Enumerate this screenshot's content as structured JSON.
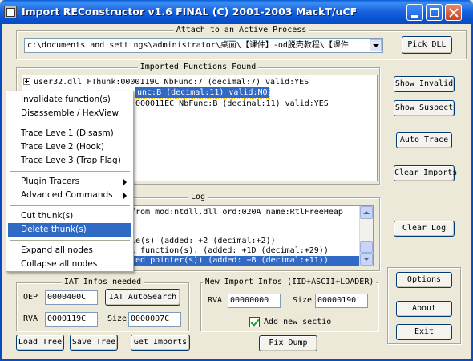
{
  "window": {
    "title": "Import REConstructor v1.6 FINAL (C) 2001-2003 MackT/uCF"
  },
  "attach": {
    "group_label": "Attach to an Active Process",
    "process_path": "c:\\documents and settings\\administrator\\桌面\\【课件】-od脱壳教程\\【课件",
    "pick_dll_label": "Pick DLL"
  },
  "imported": {
    "group_label": "Imported Functions Found",
    "rows": [
      "user32.dll FThunk:0000119C NbFunc:7 (decimal:7) valid:YES",
      "unc:B (decimal:11) valid:NO",
      "000011EC NbFunc:B (decimal:11) valid:YES"
    ]
  },
  "right_buttons": {
    "show_invalid": "Show Invalid",
    "show_suspect": "Show Suspect",
    "auto_trace": "Auto Trace",
    "clear_imports": "Clear Imports",
    "clear_log": "Clear Log",
    "options": "Options",
    "about": "About",
    "exit": "Exit"
  },
  "log": {
    "group_label": "Log",
    "lines": [
      "from mod:ntdll.dll ord:020A name:RtlFreeHeap",
      "",
      "",
      "le(s) (added: +2 (decimal:+2))",
      "l function(s). (added: +1D (decimal:+29))",
      "red pointer(s)) (added: +B (decimal:+11))"
    ]
  },
  "iat": {
    "group_label": "IAT Infos needed",
    "oep_label": "OEP",
    "oep_value": "0000400C",
    "autosearch_label": "IAT AutoSearch",
    "rva_label": "RVA",
    "rva_value": "0000119C",
    "size_label": "Size",
    "size_value": "0000007C"
  },
  "new_import": {
    "group_label": "New Import Infos (IID+ASCII+LOADER)",
    "rva_label": "RVA",
    "rva_value": "00000000",
    "size_label": "Size",
    "size_value": "00000190",
    "add_section_label": "Add new sectio"
  },
  "bottom_buttons": {
    "load_tree": "Load Tree",
    "save_tree": "Save Tree",
    "get_imports": "Get Imports",
    "fix_dump": "Fix Dump"
  },
  "context_menu": {
    "items": [
      "Invalidate function(s)",
      "Disassemble / HexView",
      "Trace Level1 (Disasm)",
      "Trace Level2 (Hook)",
      "Trace Level3 (Trap Flag)",
      "Plugin Tracers",
      "Advanced Commands",
      "Cut thunk(s)",
      "Delete thunk(s)",
      "Expand all nodes",
      "Collapse all nodes"
    ]
  }
}
